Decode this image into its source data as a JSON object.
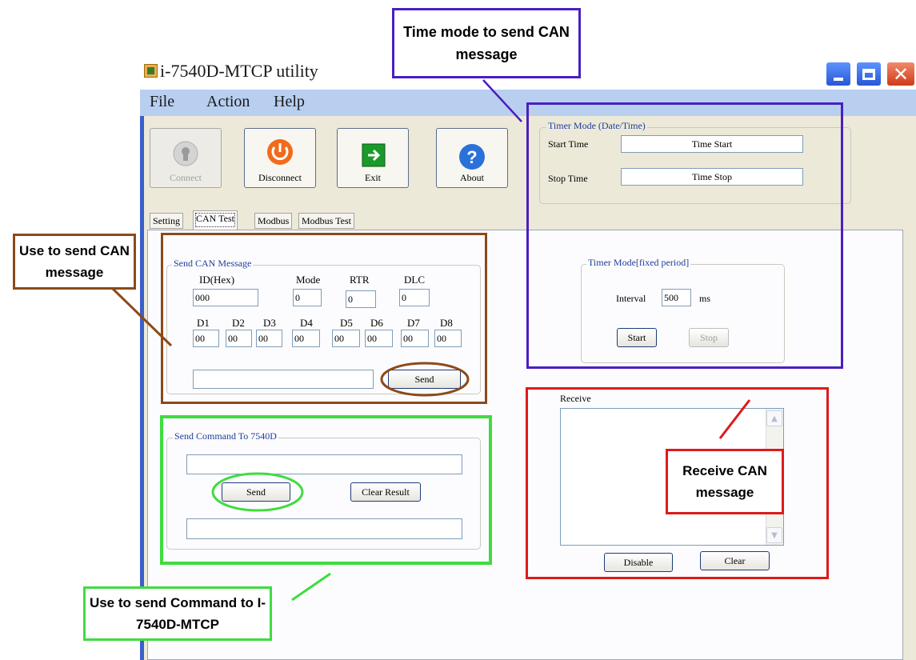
{
  "window": {
    "title": "i-7540D-MTCP utility"
  },
  "menu": [
    "File",
    "Action",
    "Help"
  ],
  "toolbar": {
    "connect": "Connect",
    "disconnect": "Disconnect",
    "exit": "Exit",
    "about": "About"
  },
  "tabs": [
    "Setting",
    "CAN Test",
    "Modbus",
    "Modbus Test"
  ],
  "timer_date": {
    "title": "Timer Mode  (Date/Time)",
    "start_label": "Start Time",
    "start_value": "Time Start",
    "stop_label": "Stop Time",
    "stop_value": "Time Stop"
  },
  "timer_fixed": {
    "title": "Timer Mode[fixed period]",
    "interval_label": "Interval",
    "interval_value": "500",
    "unit": "ms",
    "start": "Start",
    "stop": "Stop"
  },
  "send_can": {
    "title": "Send CAN Message",
    "id_label": "ID(Hex)",
    "id_value": "000",
    "mode_label": "Mode",
    "mode_value": "0",
    "rtr_label": "RTR",
    "rtr_value": "0",
    "dlc_label": "DLC",
    "dlc_value": "0",
    "data": [
      {
        "label": "D1",
        "value": "00"
      },
      {
        "label": "D2",
        "value": "00"
      },
      {
        "label": "D3",
        "value": "00"
      },
      {
        "label": "D4",
        "value": "00"
      },
      {
        "label": "D5",
        "value": "00"
      },
      {
        "label": "D6",
        "value": "00"
      },
      {
        "label": "D7",
        "value": "00"
      },
      {
        "label": "D8",
        "value": "00"
      }
    ],
    "send": "Send"
  },
  "send_cmd": {
    "title": "Send Command To 7540D",
    "send": "Send",
    "clear": "Clear Result"
  },
  "receive": {
    "label": "Receive",
    "disable": "Disable",
    "clear": "Clear"
  },
  "annotations": {
    "time_mode": "Time mode to send CAN message",
    "send_can": "Use to send CAN message",
    "send_cmd": "Use to send Command to I-7540D-MTCP",
    "receive": "Receive CAN message"
  },
  "colors": {
    "time_mode": "#4a1fbf",
    "send_can": "#8b4a1a",
    "send_cmd": "#3fdc3f",
    "receive": "#dd1a1a"
  }
}
